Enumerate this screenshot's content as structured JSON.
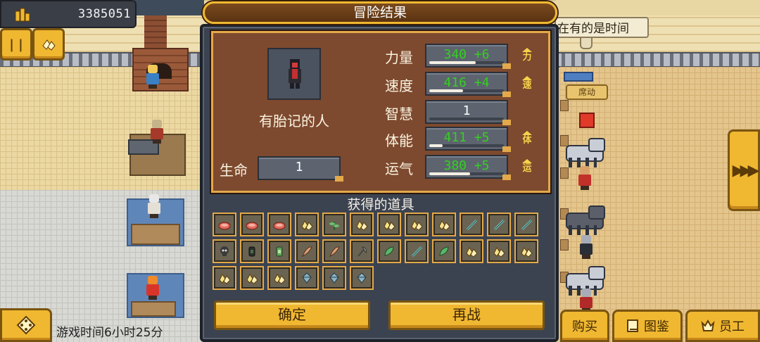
{
  "hud": {
    "money": "3385051",
    "money_icon": "building-icon",
    "pause_icon": "pause-icon",
    "items_icon": "gold-icon",
    "hint": "在有的是时间",
    "game_time": "游戏时间6小时25分",
    "right_arrow": "▶▶▶"
  },
  "world": {
    "stable_label": "席动"
  },
  "bottom_bar": {
    "buy": "购买",
    "encyclopedia": "图鉴",
    "staff": "员工"
  },
  "dialog": {
    "title": "冒险结果",
    "character_name": "有胎记的人",
    "life_label": "生命",
    "life_value": "1",
    "stats": [
      {
        "label": "力量",
        "value": "340  +6",
        "fill": 0.62,
        "color": "#34d01e",
        "up": true,
        "up_glyph": "力"
      },
      {
        "label": "速度",
        "value": "416  +4",
        "fill": 0.45,
        "color": "#34d01e",
        "up": true,
        "up_glyph": "速"
      },
      {
        "label": "智慧",
        "value": "1",
        "fill": 0.0,
        "color": "#ffffff",
        "up": false,
        "up_glyph": ""
      },
      {
        "label": "体能",
        "value": "411  +5",
        "fill": 0.18,
        "color": "#34d01e",
        "up": true,
        "up_glyph": "体"
      },
      {
        "label": "运气",
        "value": "380  +5",
        "fill": 0.55,
        "color": "#34d01e",
        "up": true,
        "up_glyph": "运"
      }
    ],
    "items_title": "获得的道具",
    "items": [
      "meat-icon",
      "meat-icon",
      "meat-icon",
      "gold-ore-icon",
      "herb-icon",
      "gold-ore-icon",
      "gold-ore-icon",
      "gold-ore-icon",
      "gold-ore-icon",
      "sword-icon",
      "sword-icon",
      "sword-icon",
      "skull-icon",
      "potion-dark-icon",
      "potion-green-icon",
      "feather-icon",
      "feather-icon",
      "axe-icon",
      "leaf-icon",
      "sword-icon",
      "leaf-icon",
      "gold-ore-icon",
      "gold-ore-icon",
      "gold-ore-icon",
      "gold-ore-icon",
      "gold-ore-icon",
      "gold-ore-icon",
      "crystal-icon",
      "crystal-icon",
      "crystal-icon"
    ],
    "confirm": "确定",
    "fight_again": "再战"
  },
  "colors": {
    "gold": "#f0b831",
    "panel_brown": "#7d4a2f",
    "dialog_dark": "#3c4350",
    "stat_green": "#34d01e"
  }
}
